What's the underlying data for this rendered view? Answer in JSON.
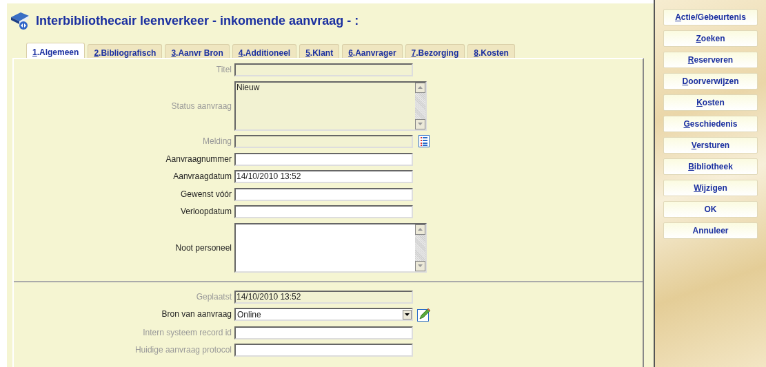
{
  "window": {
    "title": "Interbibliothecair leenverkeer - inkomende aanvraag - :"
  },
  "tabs": [
    {
      "label": "1.Algemeen",
      "selected": true
    },
    {
      "label": "2.Bibliografisch",
      "selected": false
    },
    {
      "label": "3.Aanvr Bron",
      "selected": false
    },
    {
      "label": "4.Additioneel",
      "selected": false
    },
    {
      "label": "5.Klant",
      "selected": false
    },
    {
      "label": "6.Aanvrager",
      "selected": false
    },
    {
      "label": "7.Bezorging",
      "selected": false
    },
    {
      "label": "8.Kosten",
      "selected": false
    }
  ],
  "sections": [
    {
      "fields": [
        {
          "kind": "input",
          "label": "Titel",
          "disabled": true
        },
        {
          "kind": "textarea",
          "label": "Status aanvraag",
          "value": "Nieuw",
          "disabled": true
        },
        {
          "kind": "input",
          "label": "Melding",
          "disabled": true,
          "list_button": true
        },
        {
          "kind": "input",
          "label": "Aanvraagnummer",
          "disabled": false
        },
        {
          "kind": "input",
          "label": "Aanvraagdatum",
          "value": "14/10/2010 13:52",
          "disabled": false
        },
        {
          "kind": "input",
          "label": "Gewenst vóór",
          "disabled": false
        },
        {
          "kind": "input",
          "label": "Verloopdatum",
          "disabled": false
        },
        {
          "kind": "textarea",
          "label": "Noot personeel",
          "disabled": false
        }
      ]
    },
    {
      "fields": [
        {
          "kind": "input",
          "label": "Geplaatst",
          "value": "14/10/2010 13:52",
          "disabled": true
        },
        {
          "kind": "select",
          "label": "Bron van aanvraag",
          "value": "Online",
          "disabled": false,
          "edit_button": true
        },
        {
          "kind": "input",
          "label": "Intern systeem record id",
          "disabled": true,
          "field_disabled": false
        },
        {
          "kind": "input",
          "label": "Huidige aanvraag protocol",
          "disabled": true,
          "field_disabled": false
        }
      ]
    }
  ],
  "actions": [
    {
      "label": "Actie/Gebeurtenis",
      "underline_first": true
    },
    {
      "label": "Zoeken",
      "underline_first": true
    },
    {
      "label": "Reserveren",
      "underline_first": true
    },
    {
      "label": "Doorverwijzen",
      "underline_first": true
    },
    {
      "label": "Kosten",
      "underline_first": true
    },
    {
      "label": "Geschiedenis",
      "underline_first": true
    },
    {
      "label": "Versturen",
      "underline_first": true
    },
    {
      "label": "Bibliotheek",
      "underline_first": true
    },
    {
      "label": "Wijzigen",
      "underline_first": true
    },
    {
      "label": "OK",
      "underline_first": false
    },
    {
      "label": "Annuleer",
      "underline_first": false
    }
  ]
}
